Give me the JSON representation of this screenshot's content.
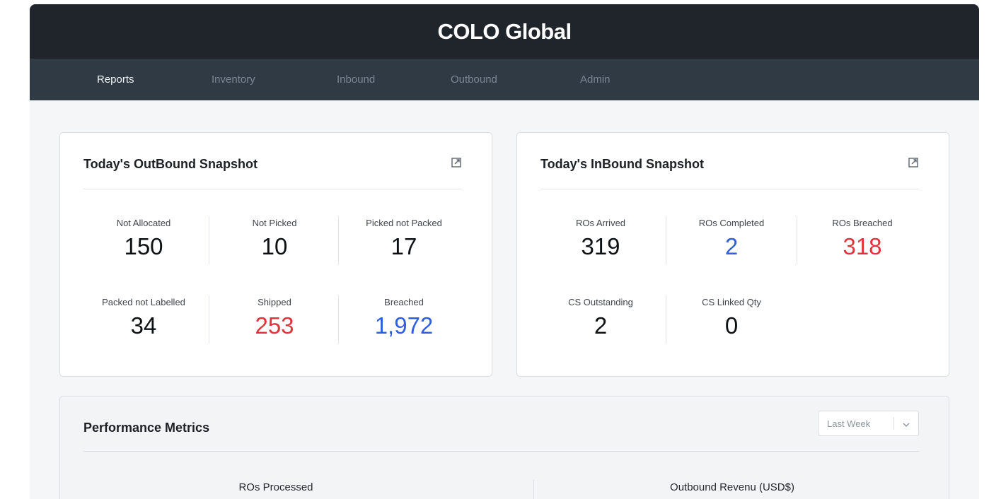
{
  "app": {
    "title": "COLO Global"
  },
  "nav": {
    "items": [
      {
        "label": "Reports",
        "active": true
      },
      {
        "label": "Inventory",
        "active": false
      },
      {
        "label": "Inbound",
        "active": false
      },
      {
        "label": "Outbound",
        "active": false
      },
      {
        "label": "Admin",
        "active": false
      }
    ]
  },
  "outbound": {
    "title": "Today's OutBound Snapshot",
    "expand_icon": "external-link-icon",
    "stats": [
      {
        "label": "Not Allocated",
        "value": "150",
        "color": "#0e1114"
      },
      {
        "label": "Not Picked",
        "value": "10",
        "color": "#0e1114"
      },
      {
        "label": "Picked not Packed",
        "value": "17",
        "color": "#0e1114"
      },
      {
        "label": "Packed not Labelled",
        "value": "34",
        "color": "#0e1114"
      },
      {
        "label": "Shipped",
        "value": "253",
        "color": "#e2333b"
      },
      {
        "label": "Breached",
        "value": "1,972",
        "color": "#2f5fe0"
      }
    ]
  },
  "inbound": {
    "title": "Today's InBound Snapshot",
    "expand_icon": "external-link-icon",
    "stats": [
      {
        "label": "ROs Arrived",
        "value": "319",
        "color": "#0e1114"
      },
      {
        "label": "ROs Completed",
        "value": "2",
        "color": "#2f5fe0"
      },
      {
        "label": "ROs Breached",
        "value": "318",
        "color": "#e2333b"
      },
      {
        "label": "CS Outstanding",
        "value": "2",
        "color": "#0e1114"
      },
      {
        "label": "CS Linked Qty",
        "value": "0",
        "color": "#0e1114"
      }
    ]
  },
  "performance": {
    "title": "Performance Metrics",
    "period": {
      "selected": "Last Week",
      "icon": "chevron-down-icon"
    },
    "metrics": [
      {
        "label": "ROs Processed"
      },
      {
        "label": "Outbound Revenu (USD$)"
      }
    ]
  },
  "colors": {
    "titlebar": "#1f252b",
    "navbar": "#2f3a45",
    "red": "#e2333b",
    "blue": "#2f5fe0"
  }
}
